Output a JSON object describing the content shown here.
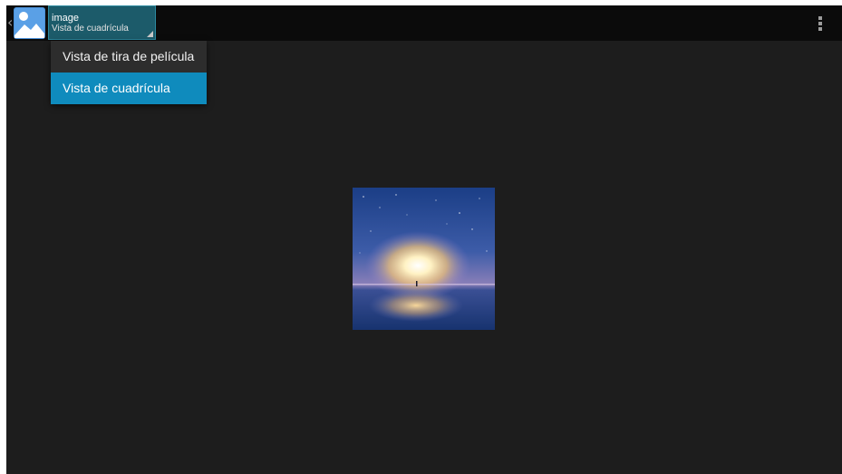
{
  "action_bar": {
    "spinner": {
      "title": "image",
      "subtitle": "Vista de cuadrícula"
    },
    "icons": [
      "back-chevron-icon",
      "gallery-app-icon",
      "overflow-menu-icon"
    ]
  },
  "view_menu": {
    "items": [
      {
        "label": "Vista de tira de película",
        "selected": false
      },
      {
        "label": "Vista de cuadrícula",
        "selected": true
      }
    ]
  },
  "grid": {
    "items": [
      {
        "type": "image",
        "subject": "starry sky over reflective salt flat at sunset"
      }
    ]
  },
  "colors": {
    "background": "#1d1d1d",
    "action_bar": "#0b0b0b",
    "spinner_bg": "#1c5b6a",
    "menu_bg": "#2d2d2d",
    "selected_item": "#0f8bbd"
  }
}
